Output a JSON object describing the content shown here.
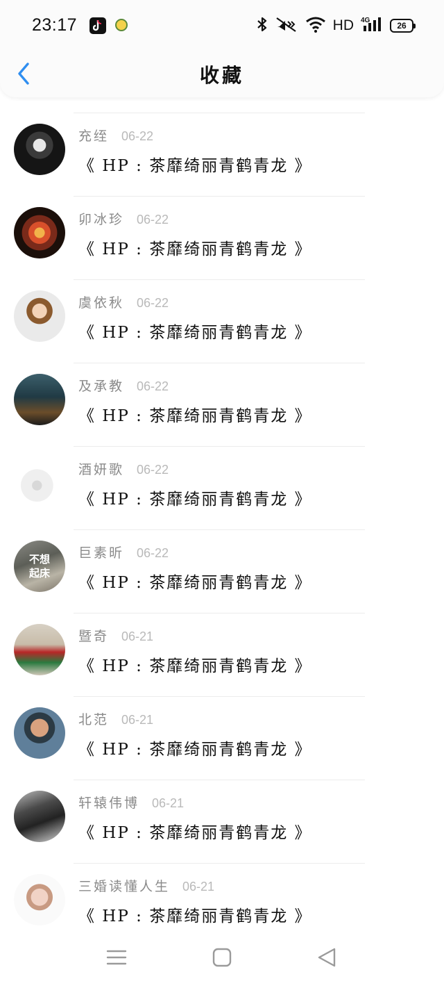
{
  "status_bar": {
    "time": "23:17",
    "network_label": "HD",
    "cell_label": "4G",
    "battery_level": "26",
    "icons": [
      "tiktok-icon",
      "app-notification-icon",
      "bluetooth-icon",
      "vibrate-icon",
      "wifi-icon",
      "signal-icon",
      "battery-icon"
    ]
  },
  "header": {
    "title": "收藏",
    "back_icon": "chevron-left-icon",
    "accent_color": "#2f8ef0"
  },
  "list": {
    "items": [
      {
        "username": "充绖",
        "date": "06-22",
        "title": "《 HP : 茶靡绮丽青鹤青龙 》"
      },
      {
        "username": "卯冰珍",
        "date": "06-22",
        "title": "《 HP : 茶靡绮丽青鹤青龙 》"
      },
      {
        "username": "虞依秋",
        "date": "06-22",
        "title": "《 HP : 茶靡绮丽青鹤青龙 》"
      },
      {
        "username": "及承教",
        "date": "06-22",
        "title": "《 HP : 茶靡绮丽青鹤青龙 》"
      },
      {
        "username": "酒妍歌",
        "date": "06-22",
        "title": "《 HP : 茶靡绮丽青鹤青龙 》"
      },
      {
        "username": "巨素昕",
        "date": "06-22",
        "title": "《 HP : 茶靡绮丽青鹤青龙 》",
        "avatar_text": [
          "不想",
          "起床"
        ]
      },
      {
        "username": "暨奇",
        "date": "06-21",
        "title": "《 HP : 茶靡绮丽青鹤青龙 》"
      },
      {
        "username": "北范",
        "date": "06-21",
        "title": "《 HP : 茶靡绮丽青鹤青龙 》"
      },
      {
        "username": "轩辕伟博",
        "date": "06-21",
        "title": "《 HP : 茶靡绮丽青鹤青龙 》"
      },
      {
        "username": "三婚读懂人生",
        "date": "06-21",
        "title": "《 HP : 茶靡绮丽青鹤青龙 》"
      }
    ]
  },
  "nav_bar": {
    "icons": [
      "menu-icon",
      "home-icon",
      "back-triangle-icon"
    ]
  }
}
